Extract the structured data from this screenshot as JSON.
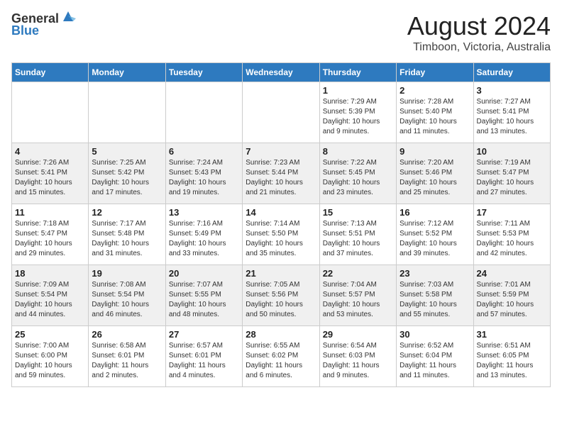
{
  "header": {
    "logo_line1": "General",
    "logo_line2": "Blue",
    "month_title": "August 2024",
    "location": "Timboon, Victoria, Australia"
  },
  "weekdays": [
    "Sunday",
    "Monday",
    "Tuesday",
    "Wednesday",
    "Thursday",
    "Friday",
    "Saturday"
  ],
  "weeks": [
    [
      {
        "day": "",
        "text": ""
      },
      {
        "day": "",
        "text": ""
      },
      {
        "day": "",
        "text": ""
      },
      {
        "day": "",
        "text": ""
      },
      {
        "day": "1",
        "text": "Sunrise: 7:29 AM\nSunset: 5:39 PM\nDaylight: 10 hours\nand 9 minutes."
      },
      {
        "day": "2",
        "text": "Sunrise: 7:28 AM\nSunset: 5:40 PM\nDaylight: 10 hours\nand 11 minutes."
      },
      {
        "day": "3",
        "text": "Sunrise: 7:27 AM\nSunset: 5:41 PM\nDaylight: 10 hours\nand 13 minutes."
      }
    ],
    [
      {
        "day": "4",
        "text": "Sunrise: 7:26 AM\nSunset: 5:41 PM\nDaylight: 10 hours\nand 15 minutes."
      },
      {
        "day": "5",
        "text": "Sunrise: 7:25 AM\nSunset: 5:42 PM\nDaylight: 10 hours\nand 17 minutes."
      },
      {
        "day": "6",
        "text": "Sunrise: 7:24 AM\nSunset: 5:43 PM\nDaylight: 10 hours\nand 19 minutes."
      },
      {
        "day": "7",
        "text": "Sunrise: 7:23 AM\nSunset: 5:44 PM\nDaylight: 10 hours\nand 21 minutes."
      },
      {
        "day": "8",
        "text": "Sunrise: 7:22 AM\nSunset: 5:45 PM\nDaylight: 10 hours\nand 23 minutes."
      },
      {
        "day": "9",
        "text": "Sunrise: 7:20 AM\nSunset: 5:46 PM\nDaylight: 10 hours\nand 25 minutes."
      },
      {
        "day": "10",
        "text": "Sunrise: 7:19 AM\nSunset: 5:47 PM\nDaylight: 10 hours\nand 27 minutes."
      }
    ],
    [
      {
        "day": "11",
        "text": "Sunrise: 7:18 AM\nSunset: 5:47 PM\nDaylight: 10 hours\nand 29 minutes."
      },
      {
        "day": "12",
        "text": "Sunrise: 7:17 AM\nSunset: 5:48 PM\nDaylight: 10 hours\nand 31 minutes."
      },
      {
        "day": "13",
        "text": "Sunrise: 7:16 AM\nSunset: 5:49 PM\nDaylight: 10 hours\nand 33 minutes."
      },
      {
        "day": "14",
        "text": "Sunrise: 7:14 AM\nSunset: 5:50 PM\nDaylight: 10 hours\nand 35 minutes."
      },
      {
        "day": "15",
        "text": "Sunrise: 7:13 AM\nSunset: 5:51 PM\nDaylight: 10 hours\nand 37 minutes."
      },
      {
        "day": "16",
        "text": "Sunrise: 7:12 AM\nSunset: 5:52 PM\nDaylight: 10 hours\nand 39 minutes."
      },
      {
        "day": "17",
        "text": "Sunrise: 7:11 AM\nSunset: 5:53 PM\nDaylight: 10 hours\nand 42 minutes."
      }
    ],
    [
      {
        "day": "18",
        "text": "Sunrise: 7:09 AM\nSunset: 5:54 PM\nDaylight: 10 hours\nand 44 minutes."
      },
      {
        "day": "19",
        "text": "Sunrise: 7:08 AM\nSunset: 5:54 PM\nDaylight: 10 hours\nand 46 minutes."
      },
      {
        "day": "20",
        "text": "Sunrise: 7:07 AM\nSunset: 5:55 PM\nDaylight: 10 hours\nand 48 minutes."
      },
      {
        "day": "21",
        "text": "Sunrise: 7:05 AM\nSunset: 5:56 PM\nDaylight: 10 hours\nand 50 minutes."
      },
      {
        "day": "22",
        "text": "Sunrise: 7:04 AM\nSunset: 5:57 PM\nDaylight: 10 hours\nand 53 minutes."
      },
      {
        "day": "23",
        "text": "Sunrise: 7:03 AM\nSunset: 5:58 PM\nDaylight: 10 hours\nand 55 minutes."
      },
      {
        "day": "24",
        "text": "Sunrise: 7:01 AM\nSunset: 5:59 PM\nDaylight: 10 hours\nand 57 minutes."
      }
    ],
    [
      {
        "day": "25",
        "text": "Sunrise: 7:00 AM\nSunset: 6:00 PM\nDaylight: 10 hours\nand 59 minutes."
      },
      {
        "day": "26",
        "text": "Sunrise: 6:58 AM\nSunset: 6:01 PM\nDaylight: 11 hours\nand 2 minutes."
      },
      {
        "day": "27",
        "text": "Sunrise: 6:57 AM\nSunset: 6:01 PM\nDaylight: 11 hours\nand 4 minutes."
      },
      {
        "day": "28",
        "text": "Sunrise: 6:55 AM\nSunset: 6:02 PM\nDaylight: 11 hours\nand 6 minutes."
      },
      {
        "day": "29",
        "text": "Sunrise: 6:54 AM\nSunset: 6:03 PM\nDaylight: 11 hours\nand 9 minutes."
      },
      {
        "day": "30",
        "text": "Sunrise: 6:52 AM\nSunset: 6:04 PM\nDaylight: 11 hours\nand 11 minutes."
      },
      {
        "day": "31",
        "text": "Sunrise: 6:51 AM\nSunset: 6:05 PM\nDaylight: 11 hours\nand 13 minutes."
      }
    ]
  ]
}
